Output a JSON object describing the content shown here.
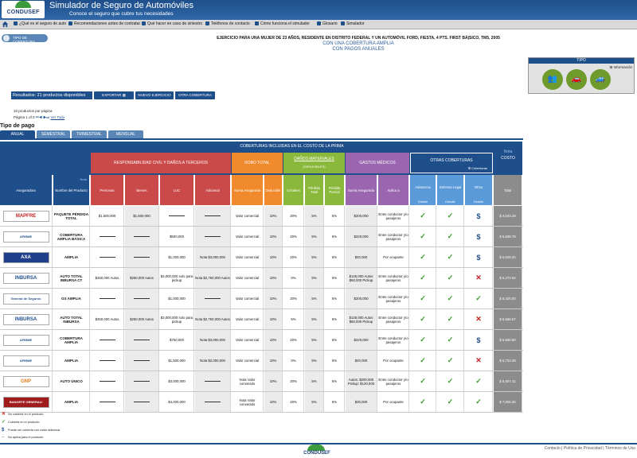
{
  "header": {
    "logo_text": "CONDUSEF",
    "title": "Simulador de Seguro de Automóviles",
    "subtitle": "Conoce el seguro que cubre tus necesidades"
  },
  "nav": [
    "¿Qué es el seguro de auto",
    "Recomendaciones antes de contratar",
    "Qué hacer en caso de siniestro",
    "Teléfonos de contacto",
    "Cómo funciona el simulador",
    "Glosario",
    "Simulador"
  ],
  "tipo_cobertura_btn": "TIPO DE COBERTURA",
  "exercise": {
    "line1": "EJERCICIO PARA UNA MUJER DE 23 AÑOS, RESIDENTE EN DISTRITO FEDERAL Y UN AUTOMÓVIL FORD, FIESTA, 4 PTS. FIRST BÁ|SICO, TM5, 2005",
    "line2": "CON UNA COBERTURA AMPLIA",
    "line3": "CON PAGOS ANUALES"
  },
  "tipo_panel": {
    "title": "TIPO",
    "info": "Información",
    "icons": [
      "people-icon",
      "car-icon",
      "car-side-icon"
    ]
  },
  "results": {
    "label": "Resultados: 21 productos disponibles",
    "export": "EXPORTAR",
    "new_exercise": "NUEVO EJERCICIO",
    "other_coverage": "OTRA COBERTURA"
  },
  "pagination": {
    "per_page": "10 productos por página",
    "page": "Página 1 of 3",
    "view_all": "Ver Todo"
  },
  "tipo_pago": "Tipo de pago",
  "tabs": [
    "ANUAL",
    "SEMESTRAL",
    "TRIMESTRAL",
    "MENSUAL"
  ],
  "table": {
    "top_header": "COBERTURAS INCLUIDAS EN EL COSTO DE LA PRIMA",
    "note": "Nota",
    "costo": "COSTO",
    "groups": {
      "rc": "RESPONSABILIDAD CIVIL Y DAÑOS A TERCEROS",
      "robo": "ROBO TOTAL",
      "danos": "DAÑOS MATERIALES",
      "danos_sub": "(DEDUCIBLES)",
      "gastos": "GASTOS MÉDICOS",
      "otras": "OTRAS COBERTURAS",
      "otras_sub": "Coberturas"
    },
    "col_headers": [
      "Aseguradora",
      "Nombre del Producto",
      "Personas",
      "Bienes",
      "LUC",
      "Adicional",
      "Suma Asegurada",
      "Deducible",
      "Cristales",
      "Pérdida Total",
      "Pérdida Parcial",
      "Suma Asegurada",
      "Aplica a",
      "Asistencia",
      "Defensa Legal",
      "Otros",
      "Total"
    ],
    "detalle": "Detalle",
    "rows": [
      {
        "insurer": "MAPFRE",
        "product": "PAQUETE PÉRDIDA TOTAL",
        "personas": "$1,500,000",
        "bienes": "$1,500,000",
        "luc": "",
        "adicional": "",
        "suma": "Valor comercial",
        "deducible": "10%",
        "cristales": "20%",
        "pt": "5%",
        "pp": "5%",
        "gm_suma": "$200,000",
        "aplica": "Entre conductor y/o pasajeros",
        "o1": "check",
        "o2": "check",
        "o3": "dollar",
        "total": "$ 4,043.29"
      },
      {
        "insurer": "AFIRME",
        "product": "COBERTURA AMPLIA BÁSICA",
        "personas": "",
        "bienes": "",
        "luc": "$500,000",
        "adicional": "",
        "suma": "Valor comercial",
        "deducible": "10%",
        "cristales": "20%",
        "pt": "5%",
        "pp": "5%",
        "gm_suma": "$220,000",
        "aplica": "Entre conductor y/o pasajeros",
        "o1": "check",
        "o2": "check",
        "o3": "dollar",
        "total": "$ 5,608.78"
      },
      {
        "insurer": "AXA",
        "product": "AMPLIA",
        "personas": "",
        "bienes": "",
        "luc": "$1,000,000",
        "adicional": "Nota $3,000,000",
        "suma": "Valor comercial",
        "deducible": "10%",
        "cristales": "20%",
        "pt": "5%",
        "pp": "5%",
        "gm_suma": "$40,000",
        "aplica": "Por ocupante",
        "o1": "check",
        "o2": "check",
        "o3": "dollar",
        "total": "$ 6,028.20"
      },
      {
        "insurer": "INBURSA",
        "product": "AUTO TOTAL INBURSA CT",
        "personas": "$250,000 Autos",
        "bienes": "$250,000 Autos",
        "luc": "$3,000,000 solo para pickup",
        "adicional": "Nota $2,750,000 Autos",
        "suma": "Valor comercial",
        "deducible": "10%",
        "cristales": "0%",
        "pt": "5%",
        "pp": "5%",
        "gm_suma": "$125,000 Autos $60,000 Pickup",
        "aplica": "Entre conductor y/o pasajeros",
        "o1": "check",
        "o2": "check",
        "o3": "x",
        "total": "$ 6,270.94"
      },
      {
        "insurer": "General de Seguros",
        "product": "GS AMPLIA",
        "personas": "",
        "bienes": "",
        "luc": "$1,000,000",
        "adicional": "",
        "suma": "Valor comercial",
        "deducible": "10%",
        "cristales": "20%",
        "pt": "5%",
        "pp": "5%",
        "gm_suma": "$200,000",
        "aplica": "Entre conductor y/o pasajeros",
        "o1": "check",
        "o2": "check",
        "o3": "check",
        "total": "$ 6,420.00"
      },
      {
        "insurer": "INBURSA",
        "product": "AUTO TOTAL INBURSA",
        "personas": "$250,000 Autos",
        "bienes": "$250,000 Autos",
        "luc": "$3,000,000 solo para pickup",
        "adicional": "Nota $2,750,000 Autos",
        "suma": "Valor comercial",
        "deducible": "10%",
        "cristales": "5%",
        "pt": "5%",
        "pp": "5%",
        "gm_suma": "$125,000 Autos $60,000 Pickup",
        "aplica": "Entre conductor y/o pasajeros",
        "o1": "check",
        "o2": "check",
        "o3": "x",
        "total": "$ 6,566.57"
      },
      {
        "insurer": "AFIRME",
        "product": "COBERTURA AMPLIA",
        "personas": "",
        "bienes": "",
        "luc": "$750,000",
        "adicional": "Nota $3,000,000",
        "suma": "Valor comercial",
        "deducible": "10%",
        "cristales": "20%",
        "pt": "5%",
        "pp": "5%",
        "gm_suma": "$220,000",
        "aplica": "Entre conductor y/o pasajeros",
        "o1": "check",
        "o2": "check",
        "o3": "dollar",
        "total": "$ 6,600.80"
      },
      {
        "insurer": "AFIRME",
        "product": "AMPLIA",
        "personas": "",
        "bienes": "",
        "luc": "$1,500,000",
        "adicional": "Nota $2,000,000",
        "suma": "Valor comercial",
        "deducible": "10%",
        "cristales": "0%",
        "pt": "5%",
        "pp": "5%",
        "gm_suma": "$40,000",
        "aplica": "Por ocupante",
        "o1": "check",
        "o2": "check",
        "o3": "x",
        "total": "$ 6,723.49"
      },
      {
        "insurer": "GNP",
        "product": "AUTO ÚNICO",
        "personas": "",
        "bienes": "",
        "luc": "$3,000,000",
        "adicional": "",
        "suma": "Nota Valor convenido",
        "deducible": "10%",
        "cristales": "20%",
        "pt": "5%",
        "pp": "5%",
        "gm_suma": "Autos: $200,000 Pickup: $120,000",
        "aplica": "Entre conductor y/o pasajeros",
        "o1": "check",
        "o2": "check",
        "o3": "check",
        "total": "$ 6,907.41"
      },
      {
        "insurer": "BANORTE GENERALI",
        "product": "AMPLIA",
        "personas": "",
        "bienes": "",
        "luc": "$4,000,000",
        "adicional": "",
        "suma": "Nota Valor convenido",
        "deducible": "10%",
        "cristales": "20%",
        "pt": "5%",
        "pp": "5%",
        "gm_suma": "$30,000",
        "aplica": "Por ocupante",
        "o1": "check",
        "o2": "check",
        "o3": "check",
        "total": "$ 7,006.30"
      }
    ]
  },
  "legend": [
    "No cubierta en el producto",
    "Cubierta en el producto",
    "Puede ser cubierta con costo adicional",
    "No aplica para el producto"
  ],
  "footer": {
    "logo_text": "CONDUSEF",
    "links": [
      "Contacto",
      "Política de Privacidad",
      "Términos de Uso"
    ]
  },
  "colors": {
    "blue": "#1f4f8a",
    "rc": "#c94a48",
    "robo": "#f08a2c",
    "danos": "#8ab83a",
    "gastos": "#9b66b0",
    "otras": "#1f4f8a",
    "assist": "#5a9ad8",
    "grey": "#8c8c8c"
  }
}
